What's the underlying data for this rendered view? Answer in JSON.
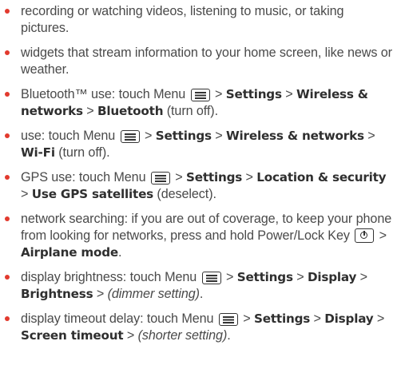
{
  "items": [
    {
      "t1": "recording or watching videos, listening to music, or taking pictures."
    },
    {
      "t1": "widgets that stream information to your home screen, like news or weather."
    },
    {
      "t1": "Bluetooth™ use: touch Menu ",
      "t2": " > ",
      "b1": "Settings",
      "t3": " > ",
      "b2": "Wireless & networks",
      "t4": " > ",
      "b3": "Bluetooth",
      "t5": " (turn off)."
    },
    {
      "t1": " use: touch Menu ",
      "t2": " > ",
      "b1": "Settings",
      "t3": " > ",
      "b2": "Wireless & networks",
      "t4": " > ",
      "b3": "Wi-Fi",
      "t5": " (turn off)."
    },
    {
      "t1": "GPS use: touch Menu ",
      "t2": " > ",
      "b1": "Settings",
      "t3": " > ",
      "b2": "Location & security",
      "t4": " > ",
      "b3": "Use GPS satellites",
      "t5": " (deselect)."
    },
    {
      "t1": "network searching: if you are out of coverage, to keep your phone from looking for networks, press and hold Power/Lock Key ",
      "t2": " > ",
      "b1": "Airplane mode",
      "t3": "."
    },
    {
      "t1": "display brightness: touch Menu ",
      "t2": " > ",
      "b1": "Settings",
      "t3": " > ",
      "b2": "Display",
      "t4": " > ",
      "b3": "Brightness",
      "t5": " > ",
      "i1": "(dimmer setting)",
      "t6": "."
    },
    {
      "t1": "display timeout delay: touch Menu ",
      "t2": " > ",
      "b1": "Settings",
      "t3": " > ",
      "b2": "Display",
      "t4": " > ",
      "b3": "Screen timeout",
      "t5": " > ",
      "i1": "(shorter setting)",
      "t6": "."
    }
  ],
  "icons": {
    "menu": "menu-key-icon",
    "power": "power-lock-key-icon"
  },
  "colors": {
    "bullet": "#e23a2e",
    "text": "#4a4a4a",
    "bold": "#2f2f2f"
  }
}
